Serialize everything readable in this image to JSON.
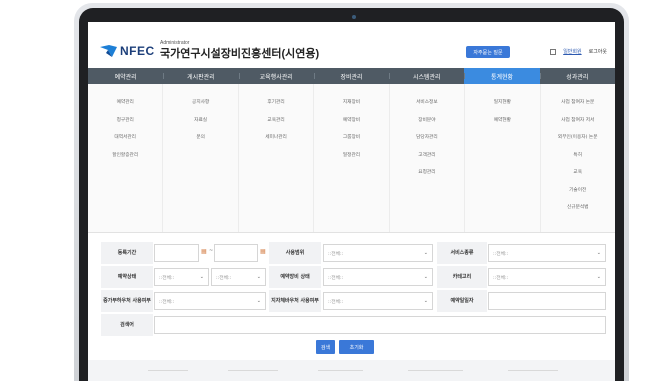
{
  "header": {
    "brand": "NFEC",
    "role": "Administrator",
    "title": "국가연구시설장비진흥센터(시연용)",
    "faq": "자주묻는 질문",
    "myinfo": "일반회원",
    "logout": "로그아웃"
  },
  "colors": {
    "nav": "#4f5a64",
    "nav_active": "#3b8be0",
    "accent": "#3a78d8",
    "brand": "#1d3f7a"
  },
  "nav": [
    "예약관리",
    "게시판관리",
    "교육행사관리",
    "장비관리",
    "시스템관리",
    "통계현황",
    "성과관리"
  ],
  "menu": [
    [
      "예약관리",
      "청구관리",
      "대역서관리",
      "할인할증관리"
    ],
    [
      "공지사항",
      "자료실",
      "문의"
    ],
    [
      "후기관리",
      "교육관리",
      "세미나관리"
    ],
    [
      "지재장비",
      "예약장비",
      "그룹장비",
      "일정관리"
    ],
    [
      "서비스정보",
      "장비분야",
      "담당자관리",
      "고객관리",
      "요청관리"
    ],
    [
      "일지현황",
      "예약현황"
    ],
    [
      "사업 참여자 논문",
      "사업 참여자 저서",
      "외부인(이용자) 논문",
      "특허",
      "교육",
      "기술이전",
      "신규분석법"
    ]
  ],
  "form": {
    "reg_period": "등록기간",
    "use_range": "사용범위",
    "service_type": "서비스종류",
    "reservation_status": "예약상태",
    "equipment_status": "예약장비 상태",
    "category": "카테고리",
    "extra_fee": "증가부하우처 사용여부",
    "voucher": "지자체바우처 사용여부",
    "reservation_date": "예약일일자",
    "search": "검색어",
    "all": "::전체::",
    "all_short": "::전체::"
  },
  "buttons": {
    "search": "검색",
    "reset": "초기화"
  }
}
